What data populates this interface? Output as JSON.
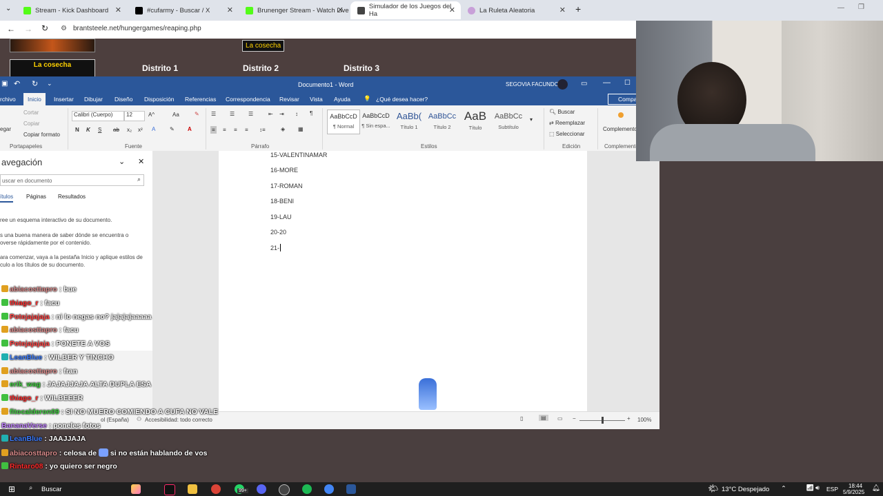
{
  "browser": {
    "tabs": [
      {
        "label": "Stream - Kick Dashboard",
        "color": "#53fc18"
      },
      {
        "label": "#cufarmy - Buscar / X",
        "color": "#000000"
      },
      {
        "label": "Brunenger Stream - Watch Live",
        "color": "#53fc18"
      },
      {
        "label": "Simulador de los Juegos del Ha",
        "color": "#444444"
      },
      {
        "label": "La Ruleta Aleatoria",
        "color": "#c8a0d8"
      }
    ],
    "url": "brantsteele.net/hungergames/reaping.php"
  },
  "site": {
    "badge_top": "La cosecha",
    "badge_left": "La cosecha",
    "districts": [
      "Distrito 1",
      "Distrito 2",
      "Distrito 3"
    ]
  },
  "word": {
    "title": "Documento1 - Word",
    "user": "SEGOVIA FACUNDO",
    "share": "Compa",
    "ribbon_tabs": [
      "rchivo",
      "Inicio",
      "Insertar",
      "Dibujar",
      "Diseño",
      "Disposición",
      "Referencias",
      "Correspondencia",
      "Revisar",
      "Vista",
      "Ayuda",
      "¿Qué desea hacer?"
    ],
    "clipboard": {
      "cut": "Cortar",
      "copy": "Copiar",
      "paste": "egar",
      "format_copy": "Copiar formato",
      "label": "Portapapeles"
    },
    "font": {
      "name": "Calibri (Cuerpo)",
      "size": "12",
      "label": "Fuente"
    },
    "paragraph_label": "Párrafo",
    "styles": [
      {
        "sample": "AaBbCcD",
        "name": "¶ Normal"
      },
      {
        "sample": "AaBbCcD",
        "name": "¶ Sin espa..."
      },
      {
        "sample": "AaBb(",
        "name": "Título 1"
      },
      {
        "sample": "AaBbCc",
        "name": "Título 2"
      },
      {
        "sample": "AaB",
        "name": "Título"
      },
      {
        "sample": "AaBbCc",
        "name": "Subtítulo"
      }
    ],
    "styles_label": "Estilos",
    "edit": {
      "find": "Buscar",
      "replace": "Reemplazar",
      "select": "Seleccionar",
      "label": "Edición"
    },
    "addins": {
      "name": "Complementos",
      "label": "Complementos"
    },
    "nav": {
      "title": "avegación",
      "search_placeholder": "uscar en documento",
      "tabs": [
        "ítulos",
        "Páginas",
        "Resultados"
      ],
      "hint1": "ree un esquema interactivo de su documento.",
      "hint2a": "s una buena manera de saber dónde se encuentra o",
      "hint2b": "overse rápidamente por el contenido.",
      "hint3a": "ara comenzar, vaya a la pestaña Inicio y aplique estilos de",
      "hint3b": "culo a los títulos de su documento."
    },
    "doc_lines": [
      "15-VALENTINAMAR",
      "16-MORE",
      "17-ROMAN",
      "18-BENI",
      "19-LAU",
      "20-20",
      "21-"
    ],
    "status": {
      "lang": "ol (España)",
      "accessibility": "Accesibilidad: todo correcto",
      "zoom": "100%"
    }
  },
  "chat": [
    {
      "user": "abiacosttapro",
      "msg": ": bue",
      "color": "#d98a8a",
      "badge": "#e0a020"
    },
    {
      "user": "thiago_r",
      "msg": ": facu",
      "color": "#ff2a2a",
      "badge": "#40c040"
    },
    {
      "user": "Potejajajaja",
      "msg": ": ni lo negas no? jajajajaaaaa",
      "color": "#ff4040",
      "badge": "#40c040"
    },
    {
      "user": "abiacosttapro",
      "msg": ": facu",
      "color": "#d98a8a",
      "badge": "#e0a020"
    },
    {
      "user": "Potejajajaja",
      "msg": ": PONETE A VOS",
      "color": "#ff4040",
      "badge": "#40c040"
    },
    {
      "user": "LeanBlue",
      "msg": ": WILBER Y TINCHO",
      "color": "#3a7bff",
      "badge": "#20b0b0"
    },
    {
      "user": "abiacosttapro",
      "msg": ": fran",
      "color": "#d98a8a",
      "badge": "#e0a020"
    },
    {
      "user": "erik_wag",
      "msg": ": JAJAJJAJA ALTA DUPLA ESA",
      "color": "#40d040",
      "badge": "#e0a020"
    },
    {
      "user": "thiago_r",
      "msg": ": WILBEEER",
      "color": "#ff2a2a",
      "badge": "#40c040"
    },
    {
      "user": "fitocalderon09",
      "msg": ": SI NO MUERO COMIENDO A CUFA NO VALE",
      "color": "#40d040",
      "badge": "#e0a020"
    },
    {
      "user": "BananaVerse",
      "msg": ": poneles fotos",
      "color": "#c080ff",
      "badge": "#000000"
    },
    {
      "user": "LeanBlue",
      "msg": ": JAAJJAJA",
      "color": "#3a7bff",
      "badge": "#20b0b0"
    },
    {
      "user": "abiacosttapro",
      "msg": ": celosa de",
      "msg2": "si no están hablando de vos",
      "color": "#d98a8a",
      "badge": "#e0a020"
    },
    {
      "user": "Rintaro08",
      "msg": ": yo quiero ser negro",
      "color": "#ff2a2a",
      "badge": "#40c040"
    }
  ],
  "taskbar": {
    "search": "Buscar",
    "weather": "13°C  Despejado",
    "lang": "ESP",
    "time": "18:44",
    "date": "5/9/2025",
    "badge": "99+"
  }
}
